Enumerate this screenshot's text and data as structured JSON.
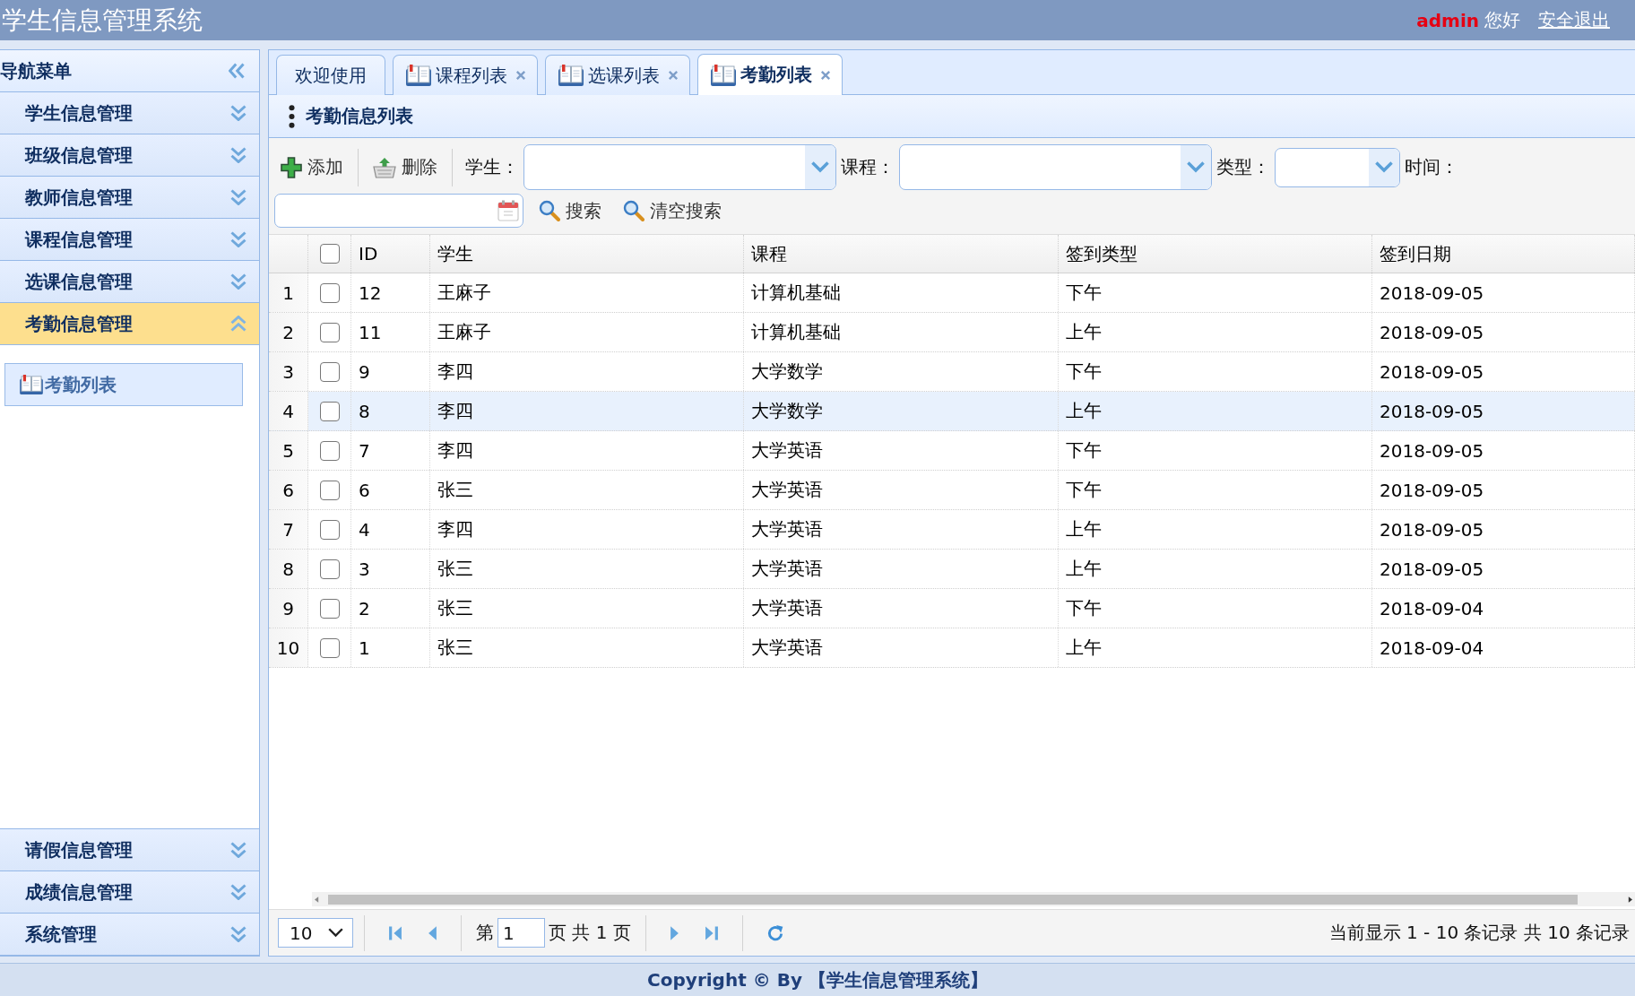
{
  "header": {
    "title": "学生信息管理系统",
    "user": "admin",
    "greeting": "您好",
    "logout": "安全退出"
  },
  "sidebar": {
    "title": "导航菜单",
    "items": [
      {
        "label": "学生信息管理",
        "expanded": false
      },
      {
        "label": "班级信息管理",
        "expanded": false
      },
      {
        "label": "教师信息管理",
        "expanded": false
      },
      {
        "label": "课程信息管理",
        "expanded": false
      },
      {
        "label": "选课信息管理",
        "expanded": false
      },
      {
        "label": "考勤信息管理",
        "expanded": true,
        "children": [
          {
            "label": "考勤列表"
          }
        ]
      },
      {
        "label": "请假信息管理",
        "expanded": false
      },
      {
        "label": "成绩信息管理",
        "expanded": false
      },
      {
        "label": "系统管理",
        "expanded": false
      }
    ]
  },
  "tabs": [
    {
      "label": "欢迎使用",
      "selected": false,
      "has_icon": false,
      "closable": false
    },
    {
      "label": "课程列表",
      "selected": false,
      "has_icon": true,
      "closable": true
    },
    {
      "label": "选课列表",
      "selected": false,
      "has_icon": true,
      "closable": true
    },
    {
      "label": "考勤列表",
      "selected": true,
      "has_icon": true,
      "closable": true
    }
  ],
  "panel": {
    "title": "考勤信息列表"
  },
  "toolbar": [
    {
      "kind": "add",
      "label": "添加"
    },
    {
      "kind": "delete",
      "label": "删除"
    },
    {
      "kind": "combo",
      "label": "学生："
    },
    {
      "kind": "combo",
      "label": "课程："
    },
    {
      "kind": "combo",
      "label": "类型："
    },
    {
      "kind": "date",
      "label": "时间："
    },
    {
      "kind": "search",
      "label": "搜索"
    },
    {
      "kind": "clear",
      "label": "清空搜索"
    }
  ],
  "table": {
    "all_checked": false,
    "columns": [
      "ID",
      "学生",
      "课程",
      "签到类型",
      "签到日期"
    ],
    "rows": [
      {
        "number": "1",
        "checked": false,
        "highlighted": false,
        "cells": [
          "12",
          "王麻子",
          "计算机基础",
          "下午",
          "2018-09-05"
        ]
      },
      {
        "number": "2",
        "checked": false,
        "highlighted": false,
        "cells": [
          "11",
          "王麻子",
          "计算机基础",
          "上午",
          "2018-09-05"
        ]
      },
      {
        "number": "3",
        "checked": false,
        "highlighted": false,
        "cells": [
          "9",
          "李四",
          "大学数学",
          "下午",
          "2018-09-05"
        ]
      },
      {
        "number": "4",
        "checked": false,
        "highlighted": true,
        "cells": [
          "8",
          "李四",
          "大学数学",
          "上午",
          "2018-09-05"
        ]
      },
      {
        "number": "5",
        "checked": false,
        "highlighted": false,
        "cells": [
          "7",
          "李四",
          "大学英语",
          "下午",
          "2018-09-05"
        ]
      },
      {
        "number": "6",
        "checked": false,
        "highlighted": false,
        "cells": [
          "6",
          "张三",
          "大学英语",
          "下午",
          "2018-09-05"
        ]
      },
      {
        "number": "7",
        "checked": false,
        "highlighted": false,
        "cells": [
          "4",
          "李四",
          "大学英语",
          "上午",
          "2018-09-05"
        ]
      },
      {
        "number": "8",
        "checked": false,
        "highlighted": false,
        "cells": [
          "3",
          "张三",
          "大学英语",
          "上午",
          "2018-09-05"
        ]
      },
      {
        "number": "9",
        "checked": false,
        "highlighted": false,
        "cells": [
          "2",
          "张三",
          "大学英语",
          "下午",
          "2018-09-04"
        ]
      },
      {
        "number": "10",
        "checked": false,
        "highlighted": false,
        "cells": [
          "1",
          "张三",
          "大学英语",
          "上午",
          "2018-09-04"
        ]
      }
    ]
  },
  "pager": {
    "page_size": "10",
    "before_text": "第",
    "page": "1",
    "after_text": "页 共 1 页",
    "info": "当前显示 1 - 10 条记录 共 10 条记录"
  },
  "footer": {
    "text": "Copyright © By 【学生信息管理系统】"
  }
}
